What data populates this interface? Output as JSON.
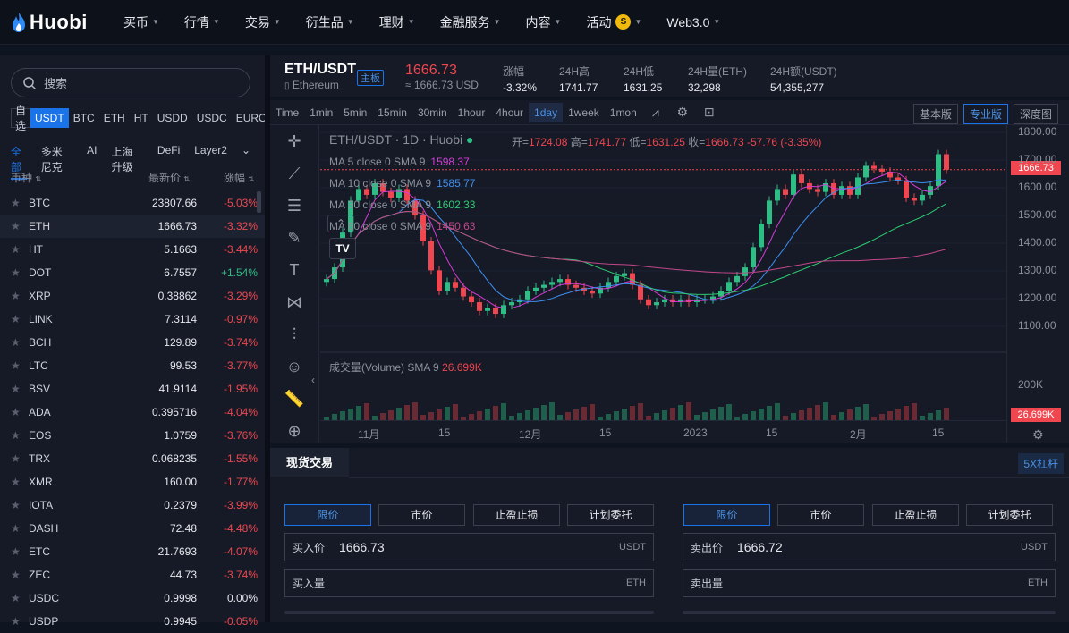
{
  "nav": {
    "brand": "Huobi",
    "items": [
      {
        "label": "买币",
        "caret": true
      },
      {
        "label": "行情",
        "caret": true
      },
      {
        "label": "交易",
        "caret": true
      },
      {
        "label": "衍生品",
        "caret": true
      },
      {
        "label": "理财",
        "caret": true
      },
      {
        "label": "金融服务",
        "caret": true
      },
      {
        "label": "内容",
        "caret": true
      },
      {
        "label": "活动",
        "caret": true,
        "badge": "S"
      },
      {
        "label": "Web3.0",
        "caret": true
      }
    ]
  },
  "sidebar": {
    "search_placeholder": "搜索",
    "quote_tabs": [
      "自选",
      "USDT",
      "BTC",
      "ETH",
      "HT",
      "USDD",
      "USDC",
      "EUROC"
    ],
    "active_quote_tab": "USDT",
    "category_tabs": [
      "全部",
      "多米尼克",
      "AI",
      "上海升级",
      "DeFi",
      "Layer2"
    ],
    "active_category": "全部",
    "columns": {
      "coin": "币种",
      "price": "最新价",
      "change": "涨幅"
    },
    "markets": [
      {
        "sym": "BTC",
        "price": "23807.66",
        "chg": "-5.03%",
        "dir": "neg"
      },
      {
        "sym": "ETH",
        "price": "1666.73",
        "chg": "-3.32%",
        "dir": "neg"
      },
      {
        "sym": "HT",
        "price": "5.1663",
        "chg": "-3.44%",
        "dir": "neg"
      },
      {
        "sym": "DOT",
        "price": "6.7557",
        "chg": "+1.54%",
        "dir": "pos"
      },
      {
        "sym": "XRP",
        "price": "0.38862",
        "chg": "-3.29%",
        "dir": "neg"
      },
      {
        "sym": "LINK",
        "price": "7.3114",
        "chg": "-0.97%",
        "dir": "neg"
      },
      {
        "sym": "BCH",
        "price": "129.89",
        "chg": "-3.74%",
        "dir": "neg"
      },
      {
        "sym": "LTC",
        "price": "99.53",
        "chg": "-3.77%",
        "dir": "neg"
      },
      {
        "sym": "BSV",
        "price": "41.9114",
        "chg": "-1.95%",
        "dir": "neg"
      },
      {
        "sym": "ADA",
        "price": "0.395716",
        "chg": "-4.04%",
        "dir": "neg"
      },
      {
        "sym": "EOS",
        "price": "1.0759",
        "chg": "-3.76%",
        "dir": "neg"
      },
      {
        "sym": "TRX",
        "price": "0.068235",
        "chg": "-1.55%",
        "dir": "neg"
      },
      {
        "sym": "XMR",
        "price": "160.00",
        "chg": "-1.77%",
        "dir": "neg"
      },
      {
        "sym": "IOTA",
        "price": "0.2379",
        "chg": "-3.99%",
        "dir": "neg"
      },
      {
        "sym": "DASH",
        "price": "72.48",
        "chg": "-4.48%",
        "dir": "neg"
      },
      {
        "sym": "ETC",
        "price": "21.7693",
        "chg": "-4.07%",
        "dir": "neg"
      },
      {
        "sym": "ZEC",
        "price": "44.73",
        "chg": "-3.74%",
        "dir": "neg"
      },
      {
        "sym": "USDC",
        "price": "0.9998",
        "chg": "0.00%",
        "dir": "zero"
      },
      {
        "sym": "USDP",
        "price": "0.9945",
        "chg": "-0.05%",
        "dir": "neg"
      }
    ]
  },
  "ticker": {
    "pair": "ETH/USDT",
    "pair_name": "Ethereum",
    "board": "主板",
    "last": "1666.73",
    "last_usd": "≈ 1666.73 USD",
    "stats": [
      {
        "k": "涨幅",
        "v": "-3.32%",
        "dir": "neg"
      },
      {
        "k": "24H高",
        "v": "1741.77",
        "dir": "zero"
      },
      {
        "k": "24H低",
        "v": "1631.25",
        "dir": "zero"
      },
      {
        "k": "24H量(ETH)",
        "v": "32,298",
        "dir": "zero"
      },
      {
        "k": "24H额(USDT)",
        "v": "54,355,277",
        "dir": "zero"
      }
    ]
  },
  "chart": {
    "timeframes": [
      "Time",
      "1min",
      "5min",
      "15min",
      "30min",
      "1hour",
      "4hour",
      "1day",
      "1week",
      "1mon"
    ],
    "active_tf": "1day",
    "views": [
      "基本版",
      "专业版",
      "深度图"
    ],
    "active_view": "专业版",
    "title": "ETH/USDT · 1D · Huobi",
    "ohlc": {
      "o_label": "开=",
      "o": "1724.08",
      "h_label": "高=",
      "h": "1741.77",
      "l_label": "低=",
      "l": "1631.25",
      "c_label": "收=",
      "c": "1666.73",
      "chg": "-57.76 (-3.35%)"
    },
    "ma_lines": [
      {
        "label": "MA 5 close 0 SMA 9",
        "value": "1598.37",
        "color": "#d63bd8"
      },
      {
        "label": "MA 10 close 0 SMA 9",
        "value": "1585.77",
        "color": "#3d8ff0"
      },
      {
        "label": "MA 30 close 0 SMA 9",
        "value": "1602.33",
        "color": "#2ecc71"
      },
      {
        "label": "MA 60 close 0 SMA 9",
        "value": "1450.63",
        "color": "#c2478a"
      }
    ],
    "volume_label": "成交量(Volume)",
    "volume_sma": "SMA 9",
    "volume_value": "26.699K",
    "price_ticks": [
      "1800.00",
      "1700.00",
      "1600.00",
      "1500.00",
      "1400.00",
      "1300.00",
      "1200.00",
      "1100.00"
    ],
    "last_price_tag": "1666.73",
    "volume_tick": "200K",
    "volume_tag": "26.699K",
    "x_ticks": [
      "11月",
      "15",
      "12月",
      "15",
      "2023",
      "15",
      "2月",
      "15"
    ]
  },
  "trade": {
    "title": "现货交易",
    "leverage": "5X杠杆",
    "order_tabs": [
      "限价",
      "市价",
      "止盈止损",
      "计划委托"
    ],
    "active_order_tab": "限价",
    "buy": {
      "price_label": "买入价",
      "price": "1666.73",
      "price_unit": "USDT",
      "amount_label": "买入量",
      "amount_unit": "ETH"
    },
    "sell": {
      "price_label": "卖出价",
      "price": "1666.72",
      "price_unit": "USDT",
      "amount_label": "卖出量",
      "amount_unit": "ETH"
    }
  },
  "chart_data": {
    "type": "candlestick",
    "ylim": [
      1050,
      1820
    ],
    "candles_close": [
      1290,
      1330,
      1450,
      1560,
      1600,
      1580,
      1620,
      1590,
      1570,
      1600,
      1560,
      1510,
      1420,
      1320,
      1250,
      1280,
      1260,
      1230,
      1210,
      1180,
      1190,
      1170,
      1200,
      1210,
      1220,
      1250,
      1260,
      1270,
      1280,
      1290,
      1270,
      1260,
      1250,
      1240,
      1260,
      1280,
      1300,
      1310,
      1270,
      1220,
      1200,
      1210,
      1220,
      1210,
      1220,
      1210,
      1220,
      1220,
      1230,
      1250,
      1280,
      1300,
      1330,
      1400,
      1480,
      1560,
      1600,
      1580,
      1650,
      1620,
      1600,
      1590,
      1620,
      1580,
      1610,
      1580,
      1640,
      1680,
      1670,
      1660,
      1640,
      1630,
      1570,
      1560,
      1580,
      1610,
      1720,
      1666.73
    ]
  }
}
